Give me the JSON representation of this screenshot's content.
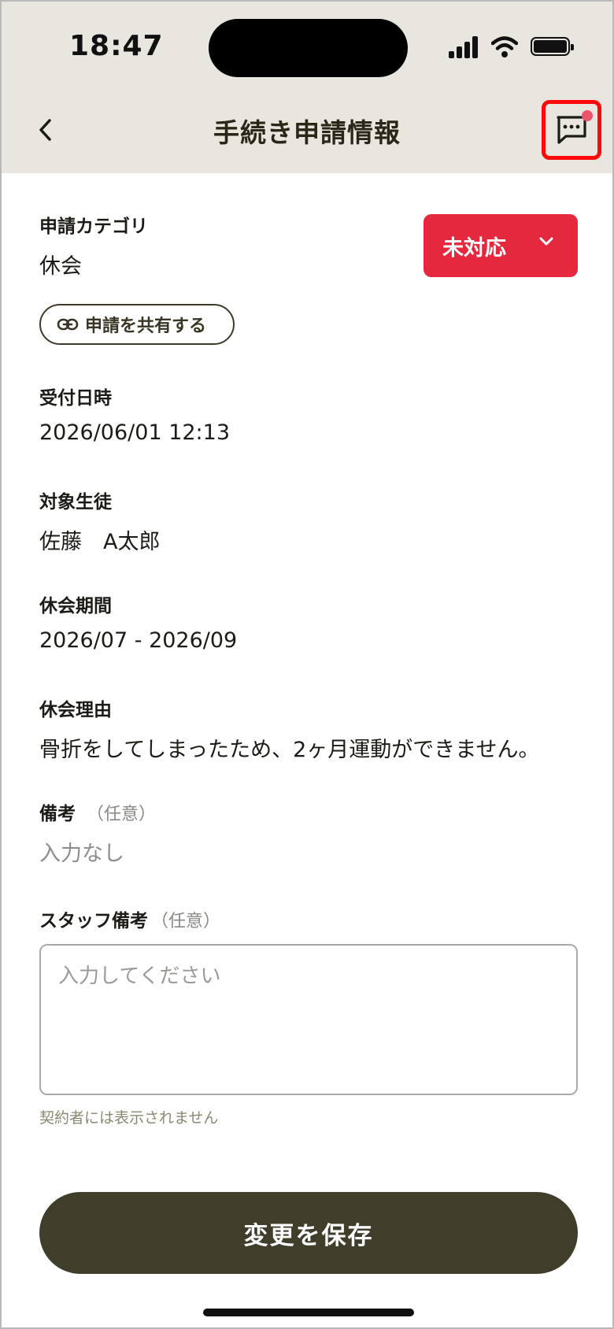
{
  "status_bar": {
    "time": "18:47"
  },
  "header": {
    "title": "手続き申請情報"
  },
  "colors": {
    "header_bg": "#e8e6df",
    "status_badge": "#e4293f",
    "primary_button": "#413d2b",
    "highlight": "#ff0a0a"
  },
  "icons": {
    "back": "chevron-left-icon",
    "chat": "chat-bubble-icon",
    "dropdown": "chevron-down-icon",
    "share": "link-icon"
  },
  "category": {
    "label": "申請カテゴリ",
    "value": "休会"
  },
  "status_dropdown": {
    "selected": "未対応"
  },
  "share_button": {
    "label": "申請を共有する"
  },
  "received": {
    "label": "受付日時",
    "value": "2026/06/01 12:13"
  },
  "student": {
    "label": "対象生徒",
    "value": "佐藤　A太郎"
  },
  "period": {
    "label": "休会期間",
    "value": "2026/07 - 2026/09"
  },
  "reason": {
    "label": "休会理由",
    "value": "骨折をしてしまったため、2ヶ月運動ができません。"
  },
  "notes": {
    "label": "備考",
    "optional": "（任意）",
    "value": "入力なし"
  },
  "staff_notes": {
    "label": "スタッフ備考",
    "optional": "（任意）",
    "placeholder": "入力してください",
    "hint": "契約者には表示されません"
  },
  "save_button": {
    "label": "変更を保存"
  }
}
